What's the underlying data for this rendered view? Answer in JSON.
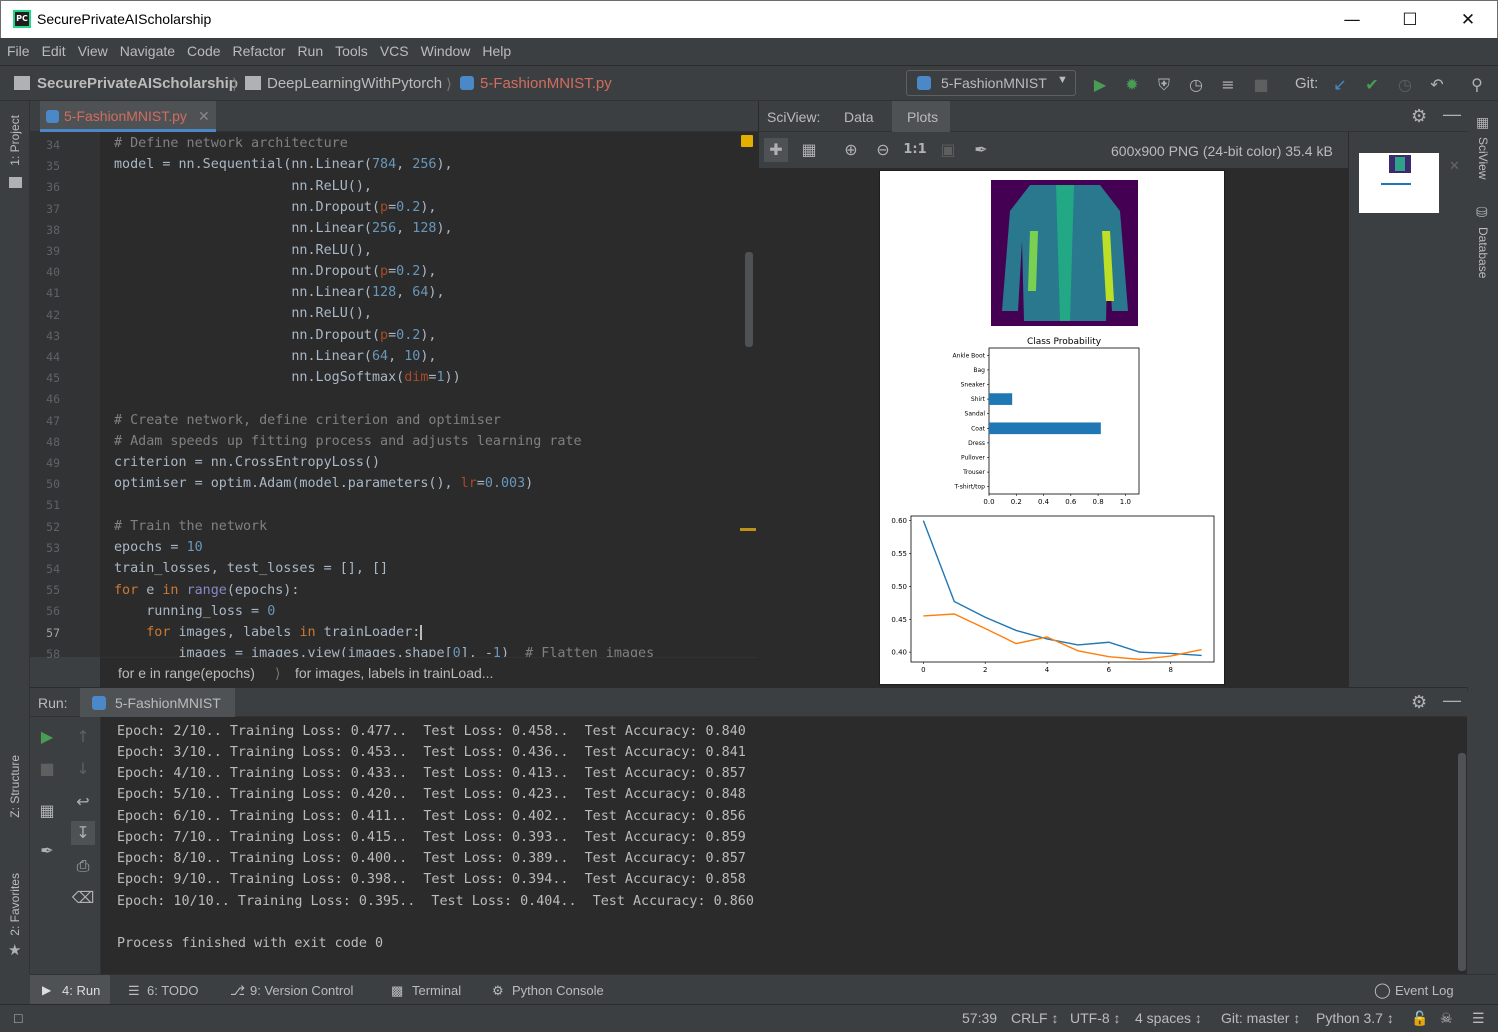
{
  "window": {
    "title": "SecurePrivateAIScholarship",
    "app_icon": "PC"
  },
  "menu": [
    "File",
    "Edit",
    "View",
    "Navigate",
    "Code",
    "Refactor",
    "Run",
    "Tools",
    "VCS",
    "Window",
    "Help"
  ],
  "navbar": {
    "crumbs": [
      "SecurePrivateAIScholarship",
      "DeepLearningWithPytorch",
      "5-FashionMNIST.py"
    ],
    "run_config": "5-FashionMNIST",
    "git_label": "Git:"
  },
  "left_strip": {
    "project": "1: Project",
    "structure": "Z: Structure",
    "favorites": "2: Favorites"
  },
  "right_strip": {
    "sciview": "SciView",
    "database": "Database"
  },
  "editor": {
    "tab": "5-FashionMNIST.py",
    "line_numbers": [
      "34",
      "35",
      "36",
      "37",
      "38",
      "39",
      "40",
      "41",
      "42",
      "43",
      "44",
      "45",
      "46",
      "47",
      "48",
      "49",
      "50",
      "51",
      "52",
      "53",
      "54",
      "55",
      "56",
      "57",
      "58"
    ],
    "breadcrumb": [
      "for e in range(epochs)",
      "for images, labels in trainLoad..."
    ]
  },
  "sciview": {
    "label": "SciView:",
    "tabs": [
      "Data",
      "Plots"
    ],
    "image_info": "600x900 PNG (24-bit color) 35.4 kB",
    "zoom_label": "1:1"
  },
  "colors": {
    "accent": "#4a88c7",
    "bar": "#1f77b4",
    "train_line": "#1f77b4",
    "test_line": "#ff7f0e",
    "run_green": "#499c54"
  },
  "chart_data": [
    {
      "type": "bar",
      "orientation": "horizontal",
      "title": "Class Probability",
      "categories": [
        "T-shirt/top",
        "Trouser",
        "Pullover",
        "Dress",
        "Coat",
        "Sandal",
        "Shirt",
        "Sneaker",
        "Bag",
        "Ankle Boot"
      ],
      "values": [
        0.0,
        0.0,
        0.0,
        0.0,
        0.82,
        0.0,
        0.17,
        0.0,
        0.0,
        0.0
      ],
      "xlim": [
        0,
        1.1
      ],
      "xticks": [
        "0.0",
        "0.2",
        "0.4",
        "0.6",
        "0.8",
        "1.0"
      ]
    },
    {
      "type": "line",
      "x": [
        0,
        1,
        2,
        3,
        4,
        5,
        6,
        7,
        8,
        9
      ],
      "series": [
        {
          "values": [
            0.6,
            0.477,
            0.453,
            0.433,
            0.42,
            0.411,
            0.415,
            0.4,
            0.398,
            0.395
          ]
        },
        {
          "values": [
            0.455,
            0.458,
            0.436,
            0.413,
            0.423,
            0.402,
            0.393,
            0.389,
            0.394,
            0.404
          ]
        }
      ],
      "ylim": [
        0.385,
        0.607
      ],
      "xlim": [
        -0.4,
        9.4
      ],
      "yticks": [
        "0.40",
        "0.45",
        "0.50",
        "0.55",
        "0.60"
      ],
      "xticks": [
        "0",
        "2",
        "4",
        "6",
        "8"
      ]
    }
  ],
  "run_panel": {
    "label": "Run:",
    "config": "5-FashionMNIST",
    "output": [
      "Epoch: 2/10.. Training Loss: 0.477..  Test Loss: 0.458..  Test Accuracy: 0.840",
      "Epoch: 3/10.. Training Loss: 0.453..  Test Loss: 0.436..  Test Accuracy: 0.841",
      "Epoch: 4/10.. Training Loss: 0.433..  Test Loss: 0.413..  Test Accuracy: 0.857",
      "Epoch: 5/10.. Training Loss: 0.420..  Test Loss: 0.423..  Test Accuracy: 0.848",
      "Epoch: 6/10.. Training Loss: 0.411..  Test Loss: 0.402..  Test Accuracy: 0.856",
      "Epoch: 7/10.. Training Loss: 0.415..  Test Loss: 0.393..  Test Accuracy: 0.859",
      "Epoch: 8/10.. Training Loss: 0.400..  Test Loss: 0.389..  Test Accuracy: 0.857",
      "Epoch: 9/10.. Training Loss: 0.398..  Test Loss: 0.394..  Test Accuracy: 0.858",
      "Epoch: 10/10.. Training Loss: 0.395..  Test Loss: 0.404..  Test Accuracy: 0.860",
      "",
      "Process finished with exit code 0"
    ]
  },
  "bottom_tabs": [
    "4: Run",
    "6: TODO",
    "9: Version Control",
    "Terminal",
    "Python Console"
  ],
  "event_log": "Event Log",
  "status": {
    "position": "57:39",
    "line_sep": "CRLF ↕",
    "encoding": "UTF-8 ↕",
    "indent": "4 spaces ↕",
    "git": "Git: master ↕",
    "interpreter": "Python 3.7 ↕"
  }
}
